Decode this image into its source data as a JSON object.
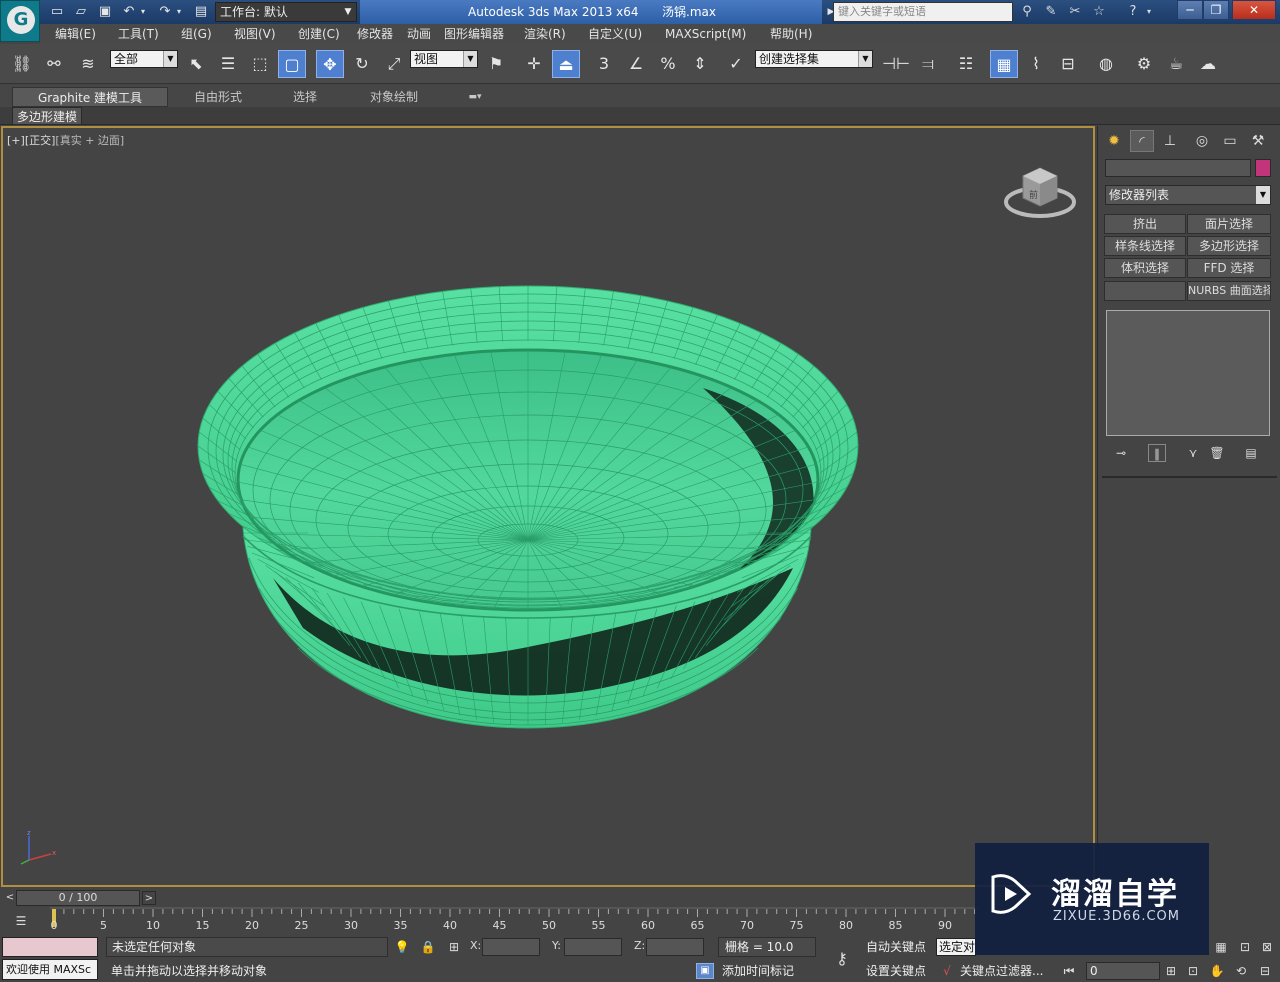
{
  "titlebar": {
    "app_logo": "G",
    "workspace_value": "工作台: 默认",
    "app_name": "Autodesk 3ds Max  2013 x64",
    "file_name": "汤锅.max",
    "search_placeholder": "键入关键字或短语",
    "minimize": "─",
    "restore": "❐",
    "close": "✕"
  },
  "menubar": {
    "items": [
      "编辑(E)",
      "工具(T)",
      "组(G)",
      "视图(V)",
      "创建(C)",
      "修改器",
      "动画",
      "图形编辑器",
      "渲染(R)",
      "自定义(U)",
      "MAXScript(M)",
      "帮助(H)"
    ]
  },
  "toolbar": {
    "selection_filter": "全部",
    "ref_coord": "视图",
    "named_selection": "创建选择集",
    "snap_label": "3",
    "percent_label": "%"
  },
  "ribbon": {
    "tabs": [
      "Graphite 建模工具",
      "自由形式",
      "选择",
      "对象绘制"
    ],
    "active_tab": 0,
    "sub_label": "多边形建模"
  },
  "viewport": {
    "label_bracket1": "[+]",
    "label_bracket2": "[正交]",
    "label_bracket3": "[真实 + 边面]",
    "cube_face": "前"
  },
  "command_panel": {
    "modifier_list": "修改器列表",
    "buttons": [
      "挤出",
      "面片选择",
      "样条线选择",
      "多边形选择",
      "体积选择",
      "FFD 选择",
      "",
      "NURBS 曲面选择"
    ]
  },
  "timeline": {
    "frame_counter": "0 / 100",
    "ticks": [
      "0",
      "5",
      "10",
      "15",
      "20",
      "25",
      "30",
      "35",
      "40",
      "45",
      "50",
      "55",
      "60",
      "65",
      "70",
      "75",
      "80",
      "85",
      "90"
    ]
  },
  "statusbar": {
    "welcome": "欢迎使用 MAXSc",
    "status_line1": "未选定任何对象",
    "status_line2": "单击并拖动以选择并移动对象",
    "x_label": "X:",
    "y_label": "Y:",
    "z_label": "Z:",
    "grid": "栅格 = 10.0",
    "add_time_tag": "添加时间标记",
    "auto_key": "自动关键点",
    "set_key": "设置关键点",
    "selected_dropdown": "选定对",
    "key_filters": "关键点过滤器...",
    "frame_value": "0"
  },
  "watermark": {
    "title": "溜溜自学",
    "subtitle": "ZIXUE.3D66.COM"
  },
  "colors": {
    "mesh": "#4fd99a",
    "mesh_wire": "#2fae72",
    "viewport_border": "#b09040",
    "object_color": "#c2357a",
    "accent": "#4f7fcf"
  }
}
